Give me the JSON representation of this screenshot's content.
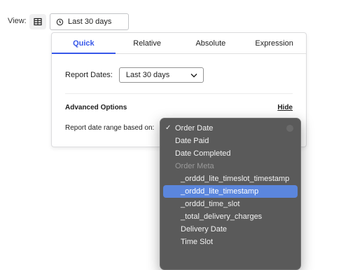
{
  "toolbar": {
    "view_label": "View:",
    "view_icon": "table-icon",
    "date_range_icon": "clock-icon",
    "date_range_value": "Last 30 days"
  },
  "panel": {
    "tabs": [
      {
        "label": "Quick",
        "active": true
      },
      {
        "label": "Relative",
        "active": false
      },
      {
        "label": "Absolute",
        "active": false
      },
      {
        "label": "Expression",
        "active": false
      }
    ],
    "report_dates_label": "Report Dates:",
    "report_dates_value": "Last 30 days",
    "advanced_title": "Advanced Options",
    "hide_label": "Hide",
    "basis_label": "Report date range based on:"
  },
  "menu": {
    "items": [
      {
        "label": "Order Date",
        "checked": true,
        "indent": false,
        "group": false,
        "selected": false
      },
      {
        "label": "Date Paid",
        "checked": false,
        "indent": false,
        "group": false,
        "selected": false
      },
      {
        "label": "Date Completed",
        "checked": false,
        "indent": false,
        "group": false,
        "selected": false
      },
      {
        "label": "Order Meta",
        "checked": false,
        "indent": false,
        "group": true,
        "selected": false
      },
      {
        "label": "_orddd_lite_timeslot_timestamp",
        "checked": false,
        "indent": true,
        "group": false,
        "selected": false
      },
      {
        "label": "_orddd_lite_timestamp",
        "checked": false,
        "indent": true,
        "group": false,
        "selected": true
      },
      {
        "label": "_orddd_time_slot",
        "checked": false,
        "indent": true,
        "group": false,
        "selected": false
      },
      {
        "label": "_total_delivery_charges",
        "checked": false,
        "indent": true,
        "group": false,
        "selected": false
      },
      {
        "label": "Delivery Date",
        "checked": false,
        "indent": true,
        "group": false,
        "selected": false
      },
      {
        "label": "Time Slot",
        "checked": false,
        "indent": true,
        "group": false,
        "selected": false
      }
    ],
    "check_glyph": "✓"
  },
  "colors": {
    "accent": "#3858e9",
    "menu_bg": "#5a5a5a",
    "menu_highlight": "#5b86dd"
  }
}
